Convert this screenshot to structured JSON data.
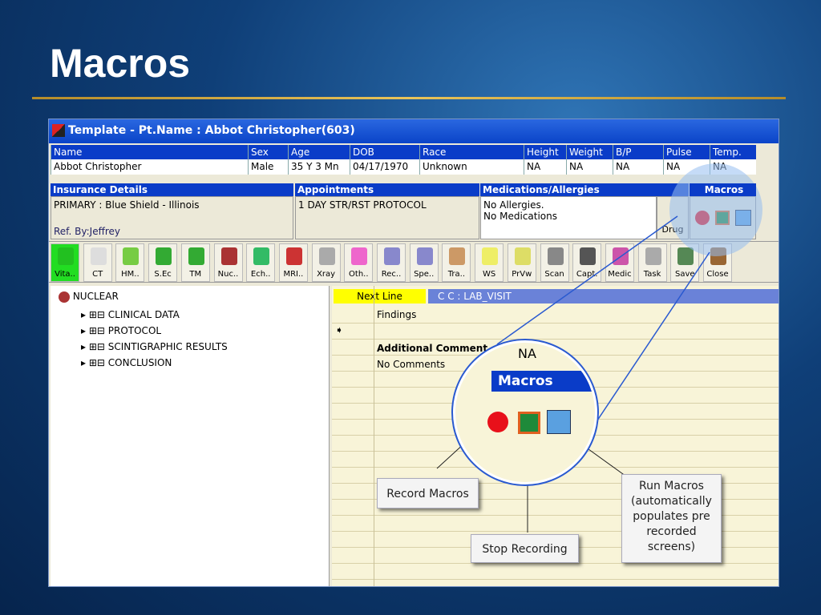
{
  "slide": {
    "title": "Macros"
  },
  "window": {
    "title": "Template - Pt.Name : Abbot Christopher(603)"
  },
  "patient": {
    "headers": [
      "Name",
      "Sex",
      "Age",
      "DOB",
      "Race",
      "Height",
      "Weight",
      "B/P",
      "Pulse",
      "Temp."
    ],
    "values": [
      "Abbot Christopher",
      "Male",
      "35 Y 3 Mn",
      "04/17/1970",
      "Unknown",
      "NA",
      "NA",
      "NA",
      "NA",
      "NA"
    ]
  },
  "sections": {
    "insurance": {
      "label": "Insurance Details",
      "value": "PRIMARY : Blue Shield - Illinois",
      "ref": "Ref. By:Jeffrey"
    },
    "appointments": {
      "label": "Appointments",
      "value": "1 DAY STR/RST PROTOCOL"
    },
    "medications": {
      "label": "Medications/Allergies",
      "line1": "No Allergies.",
      "line2": "No Medications",
      "drug": "Drug"
    },
    "macros": {
      "label": "Macros"
    }
  },
  "toolbar": [
    "Vita..",
    "CT",
    "HM..",
    "S.Ec",
    "TM",
    "Nuc..",
    "Ech..",
    "MRI..",
    "Xray",
    "Oth..",
    "Rec..",
    "Spe..",
    "Tra..",
    "WS",
    "PrVw",
    "Scan",
    "Capt.",
    "Medic",
    "Task",
    "Save",
    "Close"
  ],
  "tree": {
    "root": "NUCLEAR",
    "items": [
      "CLINICAL DATA",
      "PROTOCOL",
      "SCINTIGRAPHIC RESULTS",
      "CONCLUSION"
    ]
  },
  "tabs": {
    "next_line": "Next Line",
    "cc": "C C : LAB_VISIT"
  },
  "grid": {
    "findings": "Findings",
    "additional": "Additional Comment",
    "na": "NA",
    "no_comments": "No Comments"
  },
  "magnifier": {
    "label": "Macros"
  },
  "callouts": {
    "record": "Record Macros",
    "stop": "Stop Recording",
    "run": "Run Macros (automatically populates pre recorded screens)"
  },
  "colors": {
    "record": "#e8101a",
    "stop": "#1e8a3a",
    "header": "#0a3cc8"
  }
}
